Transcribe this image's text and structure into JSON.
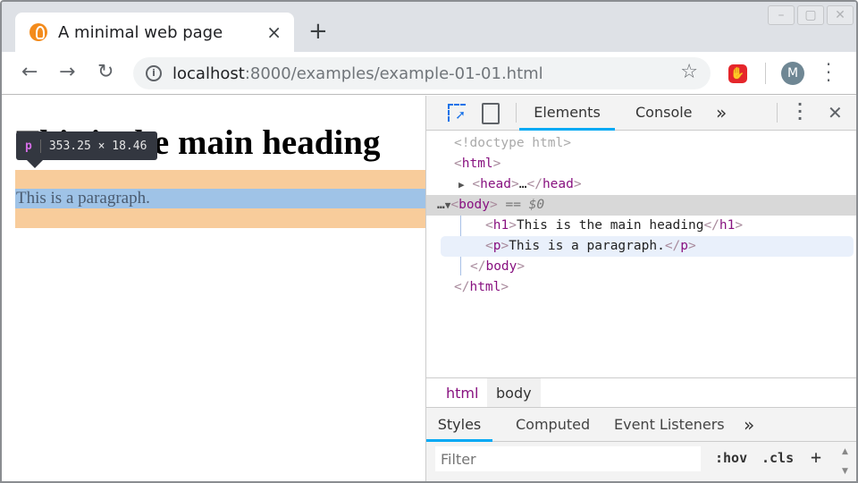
{
  "browser": {
    "tab_title": "A minimal web page",
    "tab_close": "×",
    "new_tab": "+",
    "url_host": "localhost",
    "url_rest": ":8000/examples/example-01-01.html",
    "avatar_initial": "M",
    "icons": [
      "back-arrow",
      "forward-arrow",
      "reload",
      "info",
      "star",
      "adblock-hand",
      "kebab-menu",
      "minimize",
      "maximize",
      "close"
    ]
  },
  "page": {
    "heading": "This is the main heading",
    "paragraph": "This is a paragraph.",
    "tooltip": {
      "tag": "p",
      "size": "353.25 × 18.46"
    },
    "highlight_colors": {
      "margin": "#f8cc9b",
      "content": "#9fc3e7"
    }
  },
  "devtools": {
    "tabs": [
      "Elements",
      "Console"
    ],
    "more": "»",
    "tree": {
      "doctype": "<!doctype html>",
      "html_open": "html",
      "head": "head",
      "ellipsis": "…",
      "body": "body",
      "body_marker": "== $0",
      "h1_tag": "h1",
      "h1_text": "This is the main heading",
      "p_tag": "p",
      "p_text": "This is a paragraph."
    },
    "breadcrumbs": [
      "html",
      "body"
    ],
    "style_tabs": [
      "Styles",
      "Computed",
      "Event Listeners"
    ],
    "filter_placeholder": "Filter",
    "hov": ":hov",
    "cls": ".cls",
    "add": "+"
  }
}
